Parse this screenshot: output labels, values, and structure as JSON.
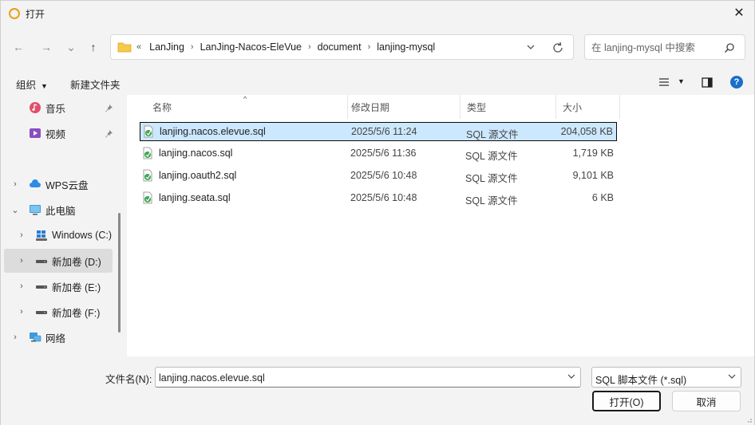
{
  "window": {
    "title": "打开",
    "close_glyph": "✕"
  },
  "nav": {
    "back_glyph": "←",
    "forward_glyph": "→",
    "recent_glyph": "⌄",
    "up_glyph": "↑",
    "breadcrumb_prefix": "«",
    "breadcrumbs": [
      "LanJing",
      "LanJing-Nacos-EleVue",
      "document",
      "lanjing-mysql"
    ],
    "breadcrumb_sep": "›",
    "search_placeholder": "在 lanjing-mysql 中搜索"
  },
  "toolbar": {
    "organize": "组织",
    "new_folder": "新建文件夹",
    "help": "?"
  },
  "sidebar": {
    "items": [
      {
        "label": "音乐",
        "icon": "music-icon",
        "pinned": true
      },
      {
        "label": "视频",
        "icon": "video-icon",
        "pinned": true
      },
      {
        "label": "WPS云盘",
        "icon": "cloud-icon",
        "chevron": "›"
      },
      {
        "label": "此电脑",
        "icon": "computer-icon",
        "chevron": "⌄"
      },
      {
        "label": "Windows (C:)",
        "icon": "windows-drive-icon",
        "chevron": "›"
      },
      {
        "label": "新加卷 (D:)",
        "icon": "drive-icon",
        "chevron": "›",
        "selected": true
      },
      {
        "label": "新加卷 (E:)",
        "icon": "drive-icon",
        "chevron": "›"
      },
      {
        "label": "新加卷 (F:)",
        "icon": "drive-icon",
        "chevron": "›"
      },
      {
        "label": "网络",
        "icon": "network-icon",
        "chevron": "›"
      }
    ]
  },
  "columns": {
    "name": "名称",
    "modified": "修改日期",
    "type": "类型",
    "size": "大小",
    "sort_glyph": "^"
  },
  "files": [
    {
      "name": "lanjing.nacos.elevue.sql",
      "modified": "2025/5/6 11:24",
      "type": "SQL 源文件",
      "size": "204,058 KB",
      "selected": true
    },
    {
      "name": "lanjing.nacos.sql",
      "modified": "2025/5/6 11:36",
      "type": "SQL 源文件",
      "size": "1,719 KB"
    },
    {
      "name": "lanjing.oauth2.sql",
      "modified": "2025/5/6 10:48",
      "type": "SQL 源文件",
      "size": "9,101 KB"
    },
    {
      "name": "lanjing.seata.sql",
      "modified": "2025/5/6 10:48",
      "type": "SQL 源文件",
      "size": "6 KB"
    }
  ],
  "footer": {
    "filename_label": "文件名(N):",
    "filename_value": "lanjing.nacos.elevue.sql",
    "filter_value": "SQL 脚本文件 (*.sql)",
    "open_button": "打开(O)",
    "cancel_button": "取消"
  },
  "colors": {
    "selection_bg": "#cce8ff",
    "accent": "#1a6fc9",
    "folder": "#f7c948"
  }
}
